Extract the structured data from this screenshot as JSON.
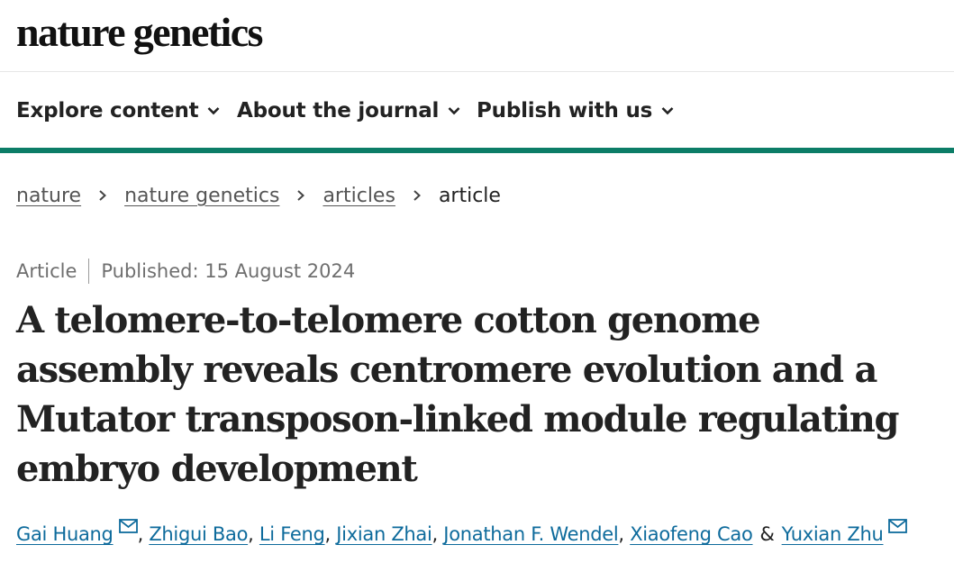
{
  "header": {
    "logo": "nature genetics"
  },
  "nav": {
    "items": [
      {
        "label": "Explore content",
        "icon": "chevron-down-icon"
      },
      {
        "label": "About the journal",
        "icon": "chevron-down-icon"
      },
      {
        "label": "Publish with us",
        "icon": "chevron-down-icon"
      }
    ],
    "accent_color": "#0c7d67"
  },
  "breadcrumb": {
    "items": [
      "nature",
      "nature genetics",
      "articles"
    ],
    "current": "article"
  },
  "article": {
    "type": "Article",
    "published": "Published: 15 August 2024",
    "title": "A telomere-to-telomere cotton genome assembly reveals centromere evolution and a Mutator transposon-linked module regulating embryo development",
    "authors": [
      {
        "name": "Gai Huang",
        "mail_icon": true
      },
      {
        "name": "Zhigui Bao",
        "mail_icon": false
      },
      {
        "name": "Li Feng",
        "mail_icon": false
      },
      {
        "name": "Jixian Zhai",
        "mail_icon": false
      },
      {
        "name": "Jonathan F. Wendel",
        "mail_icon": false
      },
      {
        "name": "Xiaofeng Cao",
        "mail_icon": false
      },
      {
        "name": "Yuxian Zhu",
        "mail_icon": true
      }
    ],
    "author_separator": ", ",
    "last_author_joiner": "&",
    "link_color": "#0e6b9c"
  }
}
